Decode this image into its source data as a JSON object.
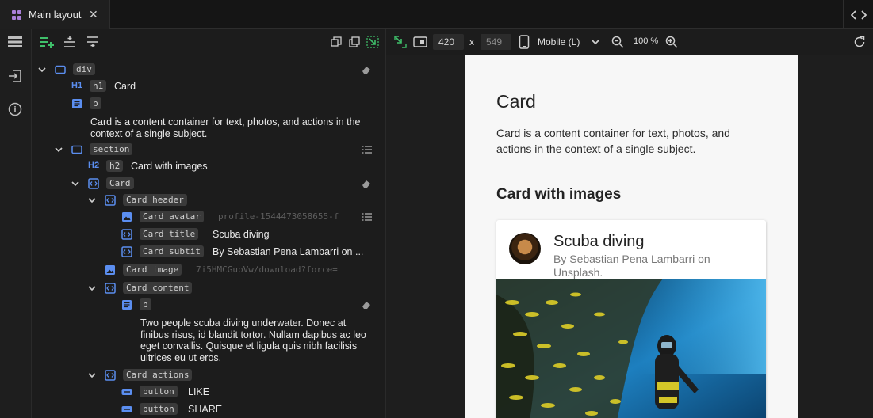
{
  "tab": {
    "label": "Main layout"
  },
  "tree": {
    "div": "div",
    "h1_label": "H1",
    "h1_tag": "h1",
    "h1_text": "Card",
    "p_tag": "p",
    "p_text": "Card is a content container for text, photos, and actions in the context of a single subject.",
    "section_tag": "section",
    "h2_label": "H2",
    "h2_tag": "h2",
    "h2_text": "Card with images",
    "card_tag": "Card",
    "card_header_tag": "Card header",
    "card_avatar_tag": "Card avatar",
    "card_avatar_value": "profile-1544473058655-f",
    "card_title_tag": "Card title",
    "card_title_value": "Scuba diving",
    "card_subtitle_tag": "Card subtit",
    "card_subtitle_value": "By Sebastian Pena Lambarri on ...",
    "card_image_tag": "Card image",
    "card_image_value": "7i5HMCGupVw/download?force=",
    "card_content_tag": "Card content",
    "content_p_tag": "p",
    "content_p_text": "Two people scuba diving underwater. Donec at finibus risus, id blandit tortor. Nullam dapibus ac leo eget convallis. Quisque et ligula quis nibh facilisis ultrices eu ut eros.",
    "card_actions_tag": "Card actions",
    "button1_tag": "button",
    "button1_text": "LIKE",
    "button2_tag": "button",
    "button2_text": "SHARE"
  },
  "preview_toolbar": {
    "width": "420",
    "x": "x",
    "height": "549",
    "device": "Mobile (L)",
    "zoom": "100 %"
  },
  "preview": {
    "h1": "Card",
    "p": "Card is a content container for text, photos, and actions in the context of a single subject.",
    "h2": "Card with images",
    "card_title": "Scuba diving",
    "card_subtitle": "By Sebastian Pena Lambarri on Unsplash."
  },
  "colors": {
    "accent_blue": "#5b8ef0",
    "accent_green": "#3fbf6a",
    "accent_purple": "#a97fd8"
  }
}
